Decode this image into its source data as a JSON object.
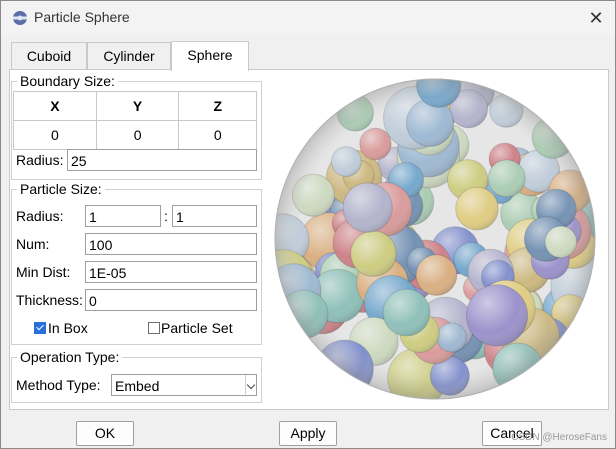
{
  "window": {
    "title": "Particle Sphere",
    "close_glyph": "✕"
  },
  "tabs": [
    {
      "label": "Cuboid",
      "active": false
    },
    {
      "label": "Cylinder",
      "active": false
    },
    {
      "label": "Sphere",
      "active": true
    }
  ],
  "boundary": {
    "legend": "Boundary Size:",
    "headers": [
      "X",
      "Y",
      "Z"
    ],
    "values": [
      "0",
      "0",
      "0"
    ],
    "radius_label": "Radius:",
    "radius_value": "25"
  },
  "particle": {
    "legend": "Particle Size:",
    "radius_label": "Radius:",
    "radius_min": "1",
    "radius_sep": ":",
    "radius_max": "1",
    "num_label": "Num:",
    "num_value": "100",
    "mindist_label": "Min Dist:",
    "mindist_value": "1E-05",
    "thickness_label": "Thickness:",
    "thickness_value": "0",
    "in_box_label": "In Box",
    "in_box_checked": true,
    "particle_set_label": "Particle Set",
    "particle_set_checked": false
  },
  "operation": {
    "legend": "Operation Type:",
    "method_label": "Method Type:",
    "method_value": "Embed"
  },
  "buttons": {
    "ok": "OK",
    "apply": "Apply",
    "cancel": "Cancel"
  },
  "watermark": "CSDN @HeroseFans",
  "preview": {
    "icon": "sphere-preview",
    "palette": [
      "#c9b06a",
      "#8b7fc7",
      "#5b9bc9",
      "#c96b73",
      "#9fc9a9",
      "#d9a46b",
      "#6b7dc9",
      "#b9c9d9",
      "#c9c96b",
      "#7bb9b0",
      "#a9a9c9",
      "#d98b8b",
      "#5a7fa9",
      "#c9d9b9",
      "#e0c96b",
      "#8fb0d0"
    ]
  }
}
